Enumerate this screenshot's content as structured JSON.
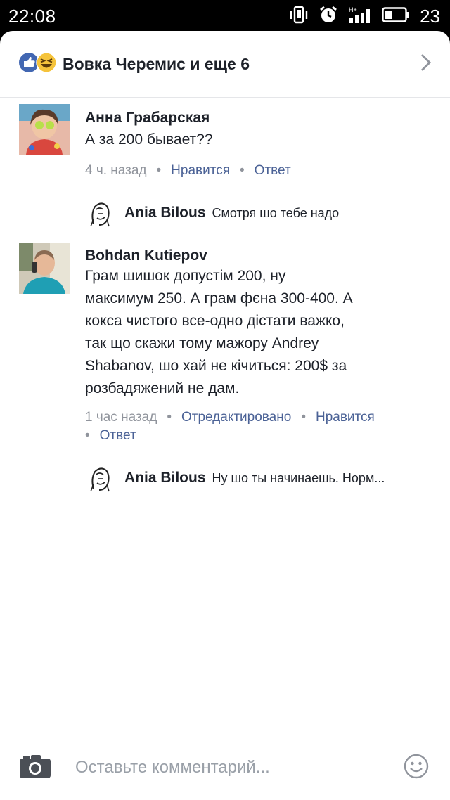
{
  "status_bar": {
    "time": "22:08",
    "battery": "23"
  },
  "reactions": {
    "text": "Вовка Черемис и еще 6"
  },
  "comments": [
    {
      "author": "Анна Грабарская",
      "text": "А за 200 бывает??",
      "time": "4 ч. назад",
      "like": "Нравится",
      "reply": "Ответ",
      "replies": [
        {
          "author": "Ania Bilous",
          "text": "Смотря шо тебе надо"
        }
      ]
    },
    {
      "author": "Bohdan Kutiepov",
      "text_lines": [
        "Грам шишок допустім 200, ну",
        "максимум 250. А грам фєна 300-400. А",
        "кокса чистого все-одно дістати важко,",
        "так що скажи тому мажору Andrey",
        "Shabanov, шо хай не кічиться: 200$ за",
        "розбадяжений не дам."
      ],
      "time": "1 час назад",
      "edited": "Отредактировано",
      "like": "Нравится",
      "reply": "Ответ",
      "replies": [
        {
          "author": "Ania Bilous",
          "text": "Ну шо ты начинаешь. Норм..."
        }
      ]
    }
  ],
  "composer": {
    "placeholder": "Оставьте комментарий..."
  },
  "colors": {
    "link": "#4b6296",
    "muted": "#90949c",
    "like_blue": "#4267b2",
    "haha_yellow": "#f5c33b"
  },
  "icons": [
    "vibrate-icon",
    "alarm-icon",
    "signal-icon",
    "battery-icon",
    "like-reaction-icon",
    "haha-reaction-icon",
    "chevron-right-icon",
    "camera-icon",
    "emoji-icon"
  ]
}
